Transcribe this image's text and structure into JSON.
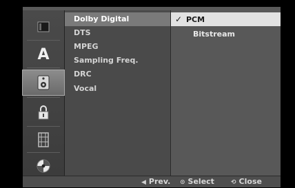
{
  "menu": {
    "items": [
      {
        "label": "Dolby Digital",
        "active": true
      },
      {
        "label": "DTS"
      },
      {
        "label": "MPEG"
      },
      {
        "label": "Sampling Freq."
      },
      {
        "label": "DRC"
      },
      {
        "label": "Vocal"
      }
    ]
  },
  "options": {
    "items": [
      {
        "label": "PCM",
        "selected": true,
        "check": "✓"
      },
      {
        "label": "Bitstream"
      }
    ]
  },
  "sidebar": {
    "icons": [
      {
        "name": "disc-tray-icon"
      },
      {
        "name": "language-a-icon",
        "glyph": "A"
      },
      {
        "name": "speaker-audio-icon",
        "active": true
      },
      {
        "name": "padlock-icon"
      },
      {
        "name": "film-strip-icon"
      },
      {
        "name": "disc-icon"
      }
    ]
  },
  "footer": {
    "prev": {
      "glyph": "◀",
      "label": "Prev."
    },
    "select": {
      "glyph": "⊙",
      "label": "Select"
    },
    "close": {
      "glyph": "⟲",
      "label": "Close"
    }
  }
}
